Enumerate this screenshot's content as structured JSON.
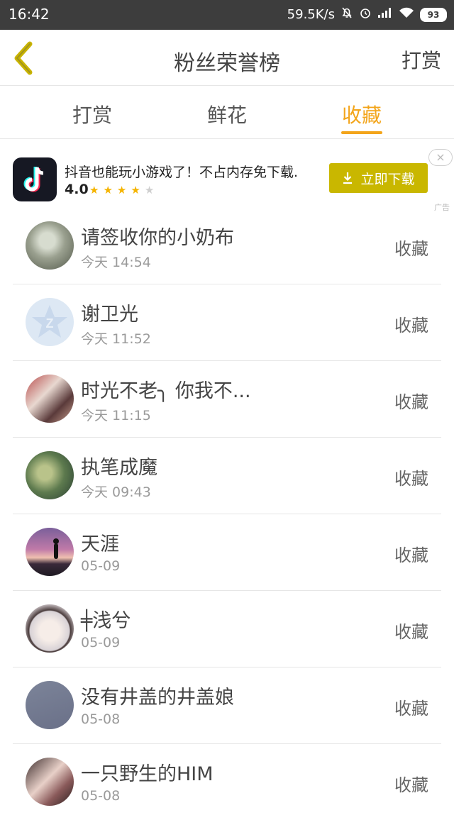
{
  "status_bar": {
    "time": "16:42",
    "network_speed": "59.5K/s",
    "battery": "93",
    "icons": [
      "bell-off-icon",
      "alarm-icon",
      "signal-icon",
      "wifi-icon",
      "battery-icon"
    ]
  },
  "header": {
    "back_icon": "chevron-left-icon",
    "title": "粉丝荣誉榜",
    "action_label": "打赏"
  },
  "tabs": {
    "items": [
      {
        "label": "打赏"
      },
      {
        "label": "鲜花"
      },
      {
        "label": "收藏"
      }
    ],
    "active": "收藏",
    "accent_color": "#f3a51b"
  },
  "ad": {
    "text": "抖音也能玩小游戏了！不占内存免下载.",
    "rating": "4.0",
    "stars_filled": 4,
    "stars_total": 5,
    "button_label": "立即下载",
    "close_label": "×",
    "tag": "广告"
  },
  "list": [
    {
      "name": "请签收你的小奶布",
      "time": "今天 14:54",
      "action": "收藏"
    },
    {
      "name": "谢卫光",
      "time": "今天 11:52",
      "action": "收藏"
    },
    {
      "name": "时光不老╮ 你我不...",
      "time": "今天 11:15",
      "action": "收藏"
    },
    {
      "name": "执笔成魔",
      "time": "今天 09:43",
      "action": "收藏"
    },
    {
      "name": "天涯",
      "time": "05-09",
      "action": "收藏"
    },
    {
      "name": "╪浅兮",
      "time": "05-09",
      "action": "收藏"
    },
    {
      "name": "没有井盖的井盖娘",
      "time": "05-08",
      "action": "收藏"
    },
    {
      "name": "一只野生的HIM",
      "time": "05-08",
      "action": "收藏"
    }
  ]
}
